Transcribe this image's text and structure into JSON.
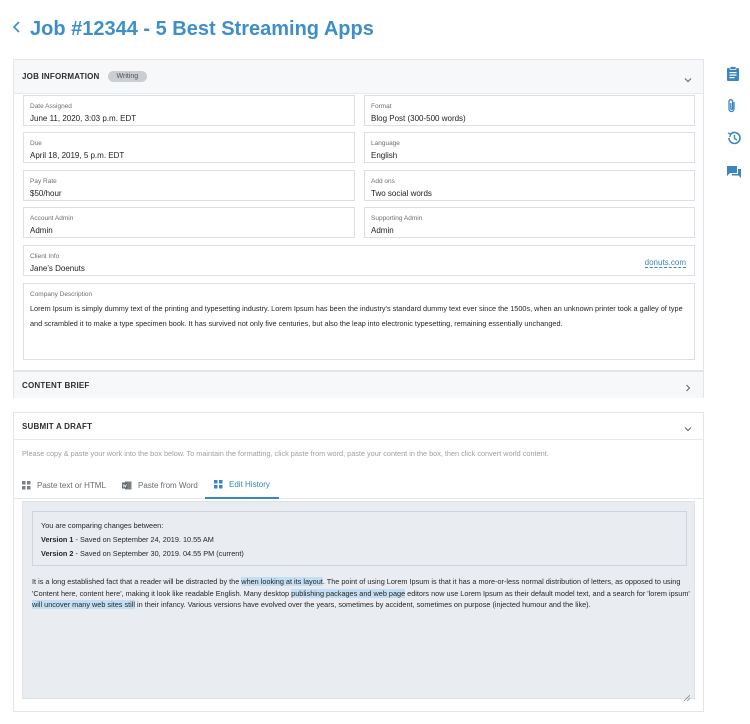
{
  "header": {
    "title": "Job #12344 - 5 Best Streaming Apps"
  },
  "job_info": {
    "title": "JOB INFORMATION",
    "badge": "Writing",
    "fields": {
      "date_assigned": {
        "label": "Date Assigned",
        "value": "June 11, 2020, 3:03 p.m. EDT"
      },
      "format": {
        "label": "Format",
        "value": "Blog Post (300-500 words)"
      },
      "due": {
        "label": "Due",
        "value": "April 18, 2019, 5 p.m. EDT"
      },
      "language": {
        "label": "Language",
        "value": "English"
      },
      "pay_rate": {
        "label": "Pay Rate",
        "value": "$50/hour"
      },
      "add_ons": {
        "label": "Add ons",
        "value": "Two social words"
      },
      "account_admin": {
        "label": "Account Admin",
        "value": "Admin"
      },
      "supporting_admin": {
        "label": "Supporting Admin",
        "value": "Admin"
      },
      "client_info": {
        "label": "Client Info",
        "value": "Jane's Doenuts",
        "link": "donuts.com"
      },
      "company_description": {
        "label": "Company Description",
        "value": "Lorem Ipsum is simply dummy text of the printing and typesetting industry. Lorem Ipsum has been the industry's standard dummy text ever since the 1500s, when an unknown printer took a galley of type and scrambled it to make a type specimen book. It has survived not only five centuries, but also the leap into electronic typesetting, remaining essentially unchanged."
      }
    }
  },
  "content_brief": {
    "title": "CONTENT BRIEF"
  },
  "submit_draft": {
    "title": "SUBMIT A DRAFT",
    "hint": "Please copy & paste your work into the box below. To maintain the formatting, click paste from word, paste your content in the box, then click convert world content.",
    "tabs": {
      "paste_text": "Paste text or HTML",
      "paste_word": "Paste from Word",
      "edit_history": "Edit History"
    },
    "compare": {
      "heading": "You are comparing changes between:",
      "v1_label": "Version 1",
      "v1_text": " - Saved on September 24, 2019. 10.55 AM",
      "v2_label": "Version 2",
      "v2_text": " - Saved on September 30, 2019. 04.55 PM (current)"
    },
    "body": {
      "p1": "It is a long established fact that a reader will be distracted by the ",
      "h1": "when looking at its layout",
      "p2": ". The point of using Lorem Ipsum is that it has a more-or-less normal distribution of letters, as opposed to using 'Content here, content here', making it look like readable English. Many desktop ",
      "h2": "publishing packages and web page",
      "p3": " editors now use Lorem Ipsum as their default model text, and a search for 'lorem ipsum' ",
      "h3": "will uncover many web sites still",
      "p4": " in their infancy. Various versions have evolved over the years, sometimes by accident, sometimes on purpose (injected humour and the like)."
    }
  },
  "colors": {
    "accent": "#3d8ec9",
    "highlight": "#c4dff3"
  },
  "icons": [
    "back-chevron-icon",
    "clipboard-icon",
    "paperclip-icon",
    "history-icon",
    "chat-icon",
    "chevron-down-icon",
    "chevron-right-icon",
    "grid-icon",
    "word-icon",
    "resize-handle-icon"
  ]
}
